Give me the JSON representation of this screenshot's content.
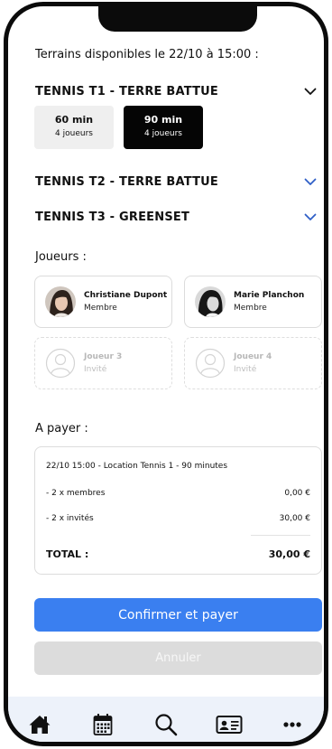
{
  "header": {
    "title": "Terrains disponibles le 22/10 à 15:00 :"
  },
  "courts": [
    {
      "name": "TENNIS T1 - TERRE BATTUE",
      "expanded": true,
      "chevron_color": "#111111",
      "icon": "chevron-down-icon"
    },
    {
      "name": "TENNIS T2 - TERRE BATTUE",
      "expanded": false,
      "chevron_color": "#2f5fc7",
      "icon": "chevron-down-icon"
    },
    {
      "name": "TENNIS T3 - GREENSET",
      "expanded": false,
      "chevron_color": "#2f5fc7",
      "icon": "chevron-down-icon"
    }
  ],
  "durations": [
    {
      "label": "60 min",
      "sub": "4 joueurs",
      "selected": false
    },
    {
      "label": "90 min",
      "sub": "4 joueurs",
      "selected": true
    }
  ],
  "players": {
    "label": "Joueurs :",
    "list": [
      {
        "name": "Christiane Dupont",
        "role": "Membre",
        "type": "member",
        "icon": "avatar"
      },
      {
        "name": "Marie Planchon",
        "role": "Membre",
        "type": "member",
        "icon": "avatar"
      },
      {
        "name": "Joueur 3",
        "role": "Invité",
        "type": "guest",
        "icon": "user-placeholder-icon"
      },
      {
        "name": "Joueur 4",
        "role": "Invité",
        "type": "guest",
        "icon": "user-placeholder-icon"
      }
    ]
  },
  "payment": {
    "label": "A payer :",
    "description": "22/10 15:00 - Location Tennis 1 - 90 minutes",
    "lines": [
      {
        "label": "- 2 x membres",
        "amount": "0,00 €"
      },
      {
        "label": "- 2 x invités",
        "amount": "30,00 €"
      }
    ],
    "total_label": "TOTAL :",
    "total_amount": "30,00 €"
  },
  "actions": {
    "confirm": "Confirmer et payer",
    "cancel": "Annuler"
  },
  "tabbar": [
    "home-icon",
    "calendar-icon",
    "search-icon",
    "id-card-icon",
    "more-icon"
  ],
  "colors": {
    "accent": "#3a7ff0",
    "selected": "#050505",
    "tabbar_bg": "#edf2fa"
  }
}
